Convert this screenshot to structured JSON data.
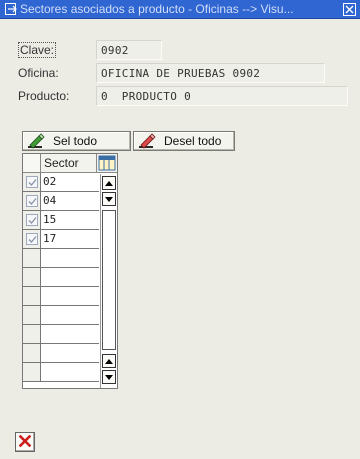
{
  "window": {
    "title": "Sectores asociados a producto - Oficinas --> Visu..."
  },
  "fields": {
    "clave": {
      "label": "Clave:",
      "value": "0902"
    },
    "oficina": {
      "label": "Oficina:",
      "value": "OFICINA DE PRUEBAS 0902"
    },
    "producto": {
      "label": "Producto:",
      "value": "0  PRODUCTO 0"
    }
  },
  "toolbar": {
    "select_all": "Sel todo",
    "deselect_all": "Desel todo"
  },
  "table": {
    "column_header": "Sector",
    "rows": [
      {
        "sector": "02",
        "checked": true
      },
      {
        "sector": "04",
        "checked": true
      },
      {
        "sector": "15",
        "checked": true
      },
      {
        "sector": "17",
        "checked": true
      },
      {
        "sector": "",
        "checked": false
      },
      {
        "sector": "",
        "checked": false
      },
      {
        "sector": "",
        "checked": false
      },
      {
        "sector": "",
        "checked": false
      },
      {
        "sector": "",
        "checked": false
      },
      {
        "sector": "",
        "checked": false
      },
      {
        "sector": "",
        "checked": false
      }
    ]
  },
  "colors": {
    "titlebar": "#2f66d1",
    "background": "#ecebe4",
    "close_red": "#cc1d1d"
  }
}
